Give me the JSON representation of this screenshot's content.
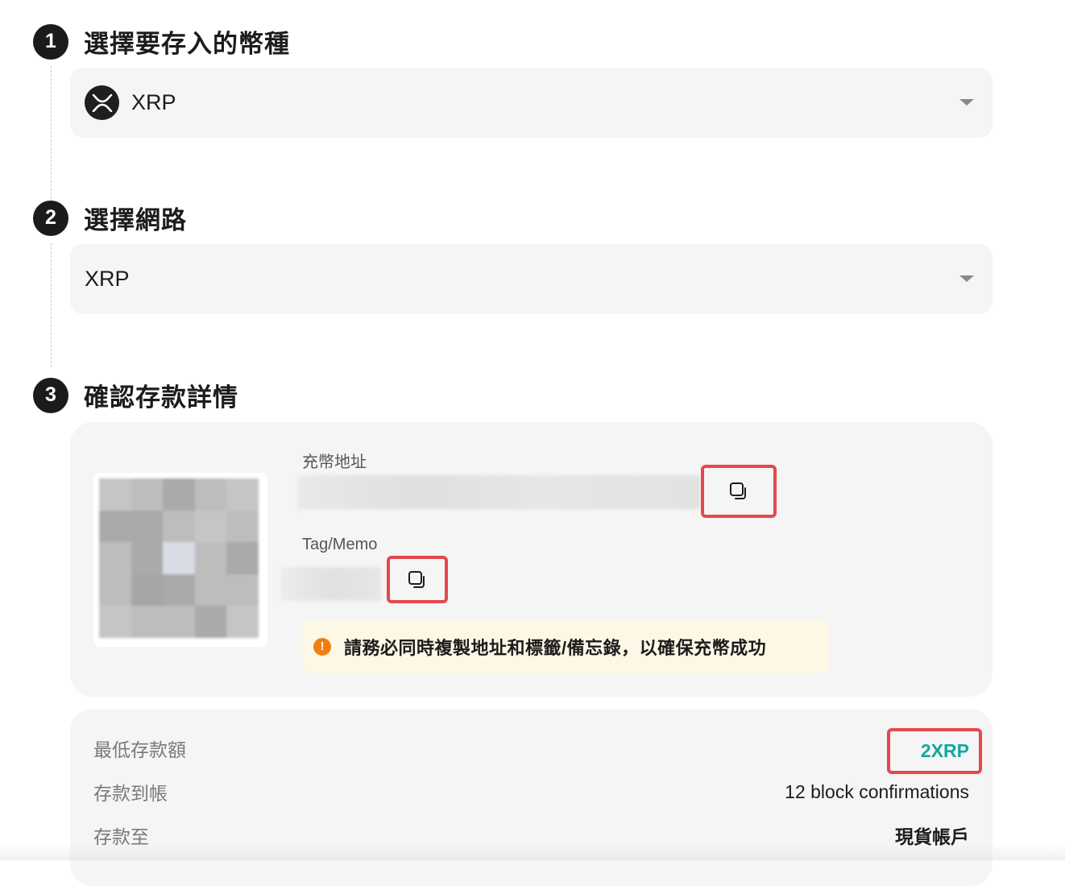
{
  "steps": [
    {
      "number": "1",
      "title": "選擇要存入的幣種"
    },
    {
      "number": "2",
      "title": "選擇網路"
    },
    {
      "number": "3",
      "title": "確認存款詳情"
    }
  ],
  "coin_select": {
    "value": "XRP",
    "icon": "xrp-logo-icon"
  },
  "network_select": {
    "value": "XRP"
  },
  "deposit_details": {
    "address_label": "充幣地址",
    "tag_label": "Tag/Memo",
    "copy_icon": "copy-icon",
    "warning": "請務必同時複製地址和標籤/備忘錄，以確保充幣成功"
  },
  "info": {
    "min_deposit_label": "最低存款額",
    "min_deposit_value": "2XRP",
    "arrival_label": "存款到帳",
    "arrival_value": "12 block confirmations",
    "deposit_to_label": "存款至",
    "deposit_to_value": "現貨帳戶"
  },
  "colors": {
    "highlight_border": "#e5484d",
    "accent_teal": "#13a89e",
    "warning_orange": "#f07f11"
  }
}
